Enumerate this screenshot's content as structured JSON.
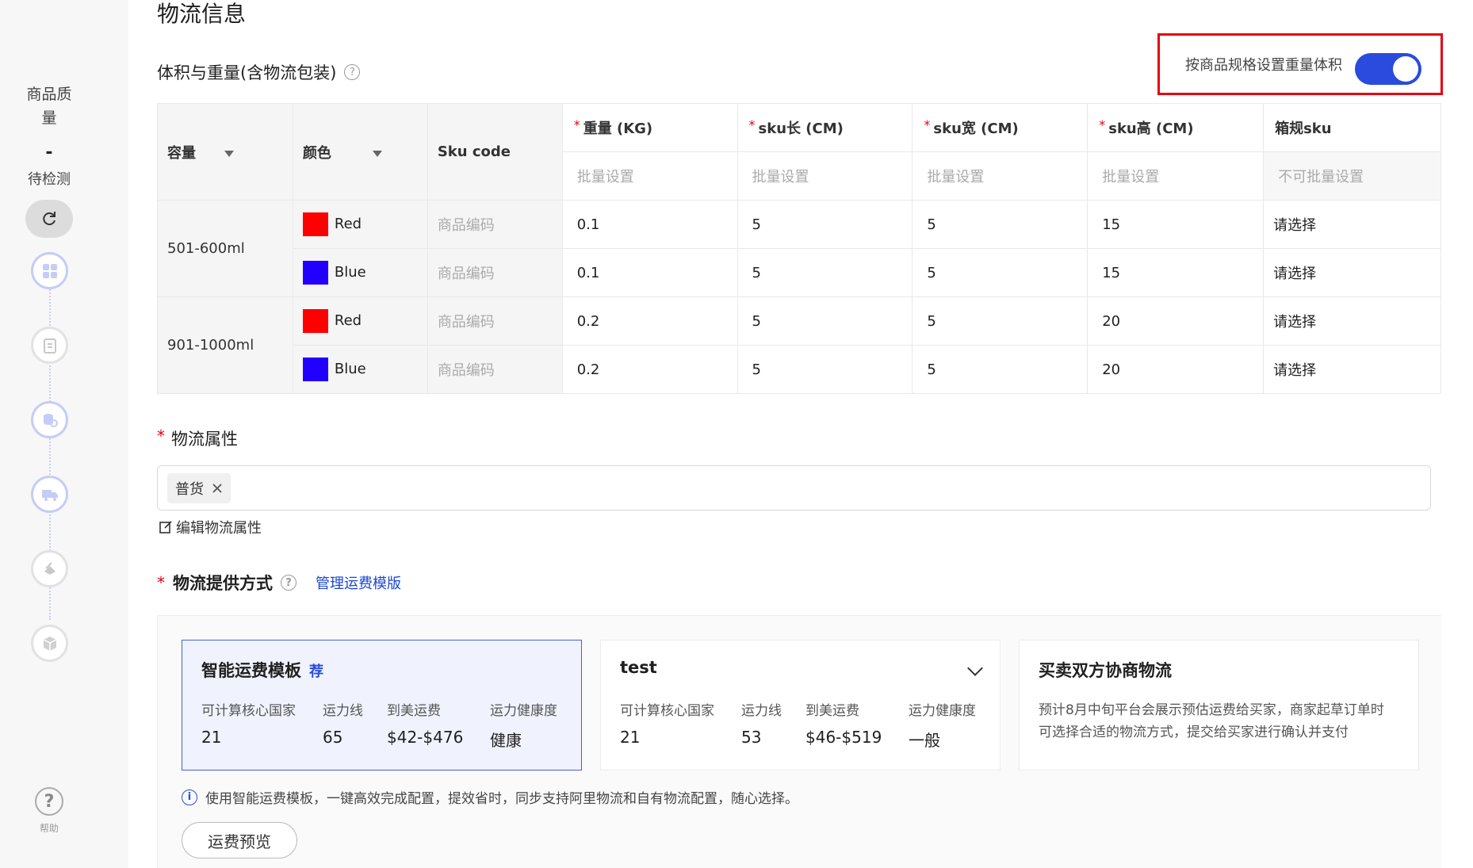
{
  "sidebar": {
    "quality_line1": "商品质",
    "quality_line2": "量",
    "dash": "-",
    "status": "待检测",
    "help_label": "帮助"
  },
  "page_title": "物流信息",
  "volume_section": {
    "title": "体积与重量(含物流包装)",
    "toggle_label": "按商品规格设置重量体积",
    "toggle_on": true
  },
  "table": {
    "headers": {
      "capacity": "容量",
      "color": "颜色",
      "sku_code": "Sku code",
      "weight": "重量 (KG)",
      "length": "sku长 (CM)",
      "width": "sku宽 (CM)",
      "height": "sku高 (CM)",
      "box_sku": "箱规sku"
    },
    "batch_placeholder": "批量设置",
    "batch_disabled": "不可批量设置",
    "sku_placeholder": "商品编码",
    "select_placeholder": "请选择",
    "groups": [
      {
        "capacity": "501-600ml",
        "rows": [
          {
            "color": "Red",
            "swatch": "#ff0000",
            "weight": "0.1",
            "length": "5",
            "width": "5",
            "height": "15"
          },
          {
            "color": "Blue",
            "swatch": "#2200ff",
            "weight": "0.1",
            "length": "5",
            "width": "5",
            "height": "15"
          }
        ]
      },
      {
        "capacity": "901-1000ml",
        "rows": [
          {
            "color": "Red",
            "swatch": "#ff0000",
            "weight": "0.2",
            "length": "5",
            "width": "5",
            "height": "20"
          },
          {
            "color": "Blue",
            "swatch": "#2200ff",
            "weight": "0.2",
            "length": "5",
            "width": "5",
            "height": "20"
          }
        ]
      }
    ]
  },
  "logistics_attr": {
    "label": "物流属性",
    "tag": "普货",
    "edit_label": "编辑物流属性"
  },
  "method": {
    "label": "物流提供方式",
    "manage_link": "管理运费模版",
    "cards": [
      {
        "title": "智能运费模板",
        "badge": "荐",
        "h1": "可计算核心国家",
        "h2": "运力线",
        "h3": "到美运费",
        "h4": "运力健康度",
        "v1": "21",
        "v2": "65",
        "v3": "$42-$476",
        "v4": "健康"
      },
      {
        "title": "test",
        "h1": "可计算核心国家",
        "h2": "运力线",
        "h3": "到美运费",
        "h4": "运力健康度",
        "v1": "21",
        "v2": "53",
        "v3": "$46-$519",
        "v4": "一般"
      },
      {
        "title": "买卖双方协商物流",
        "desc": "预计8月中旬平台会展示预估运费给买家，商家起草订单时可选择合适的物流方式，提交给买家进行确认并支付"
      }
    ],
    "info": "使用智能运费模板，一键高效完成配置，提效省时，同步支持阿里物流和自有物流配置，随心选择。",
    "preview_button": "运费预览"
  },
  "colors": {
    "accent": "#2a4bde",
    "required": "#e60012",
    "highlight_box": "#e60012"
  }
}
